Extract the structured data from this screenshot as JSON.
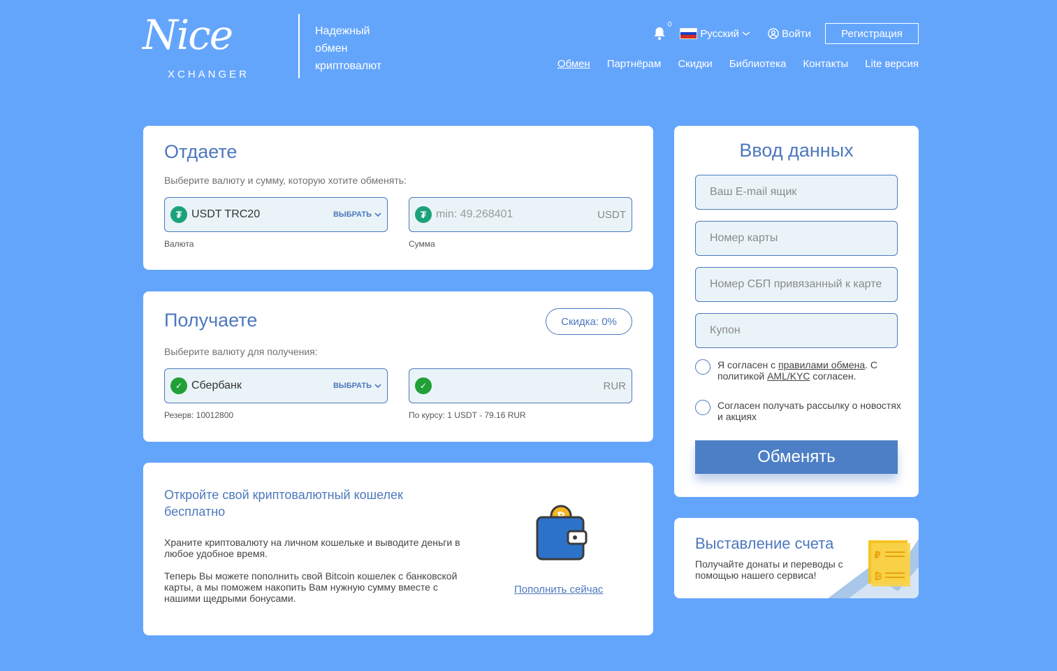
{
  "logo": {
    "script": "Nice",
    "sub": "XCHANGER"
  },
  "tagline": [
    "Надежный",
    "обмен",
    "криптовалют"
  ],
  "header": {
    "notif_count": "0",
    "language": "Русский",
    "login": "Войти",
    "register": "Регистрация"
  },
  "nav": [
    "Обмен",
    "Партнёрам",
    "Скидки",
    "Библиотека",
    "Контакты",
    "Lite версия"
  ],
  "give": {
    "title": "Отдаете",
    "hint": "Выберите валюту и сумму, которую хотите обменять:",
    "currency": "USDT TRC20",
    "choose": "ВЫБРАТЬ",
    "amount_placeholder": "min: 49.268401",
    "unit": "USDT",
    "currency_caption": "Валюта",
    "amount_caption": "Сумма"
  },
  "get": {
    "title": "Получаете",
    "discount": "Скидка: 0%",
    "hint": "Выберите валюту для получения:",
    "currency": "Сбербанк",
    "choose": "ВЫБРАТЬ",
    "unit": "RUR",
    "reserve": "Резерв: 10012800",
    "rate": "По курсу: 1 USDT - 79.16 RUR"
  },
  "wallet": {
    "title": "Откройте свой криптовалютный кошелек бесплатно",
    "text1": "Храните криптовалюту на личном кошельке и выводите деньги в любое удобное время.",
    "text2": "Теперь Вы можете пополнить свой Bitcoin кошелек с банковской карты, а мы поможем накопить Вам нужную сумму вместе с нашими щедрыми бонусами.",
    "link": "Пополнить сейчас"
  },
  "data_form": {
    "title": "Ввод данных",
    "email_placeholder": "Ваш E-mail ящик",
    "card_placeholder": "Номер карты",
    "sbp_placeholder": "Номер СБП привязанный к карте",
    "coupon_placeholder": "Купон",
    "agree_1a": "Я согласен с ",
    "agree_1_link1": "правилами обмена",
    "agree_1b": ". С политикой ",
    "agree_1_link2": "AML/KYC",
    "agree_1c": " согласен.",
    "agree_2": "Согласен получать рассылку о новостях и акциях",
    "submit": "Обменять"
  },
  "invoice": {
    "title": "Выставление счета",
    "text": "Получайте донаты и переводы с помощью нашего сервиса!"
  },
  "colors": {
    "background": "#64a5fc",
    "accent": "#4d78bd",
    "button": "#4d7fc6",
    "field_bg": "#eaf4f8"
  },
  "icons": [
    "bell-icon",
    "russia-flag-icon",
    "user-icon",
    "tether-icon",
    "sberbank-icon",
    "chevron-down-icon",
    "wallet-bitcoin-icon",
    "invoice-icon"
  ]
}
